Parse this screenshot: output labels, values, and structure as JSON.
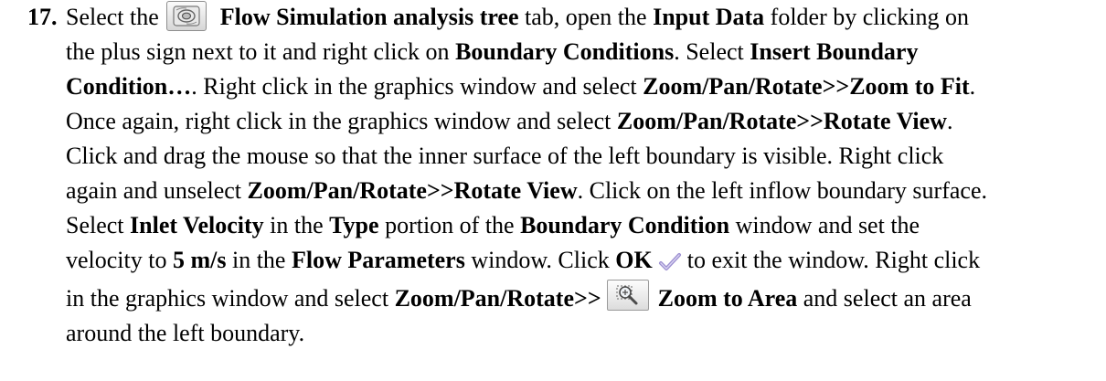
{
  "step": {
    "number": "17.",
    "l1": {
      "t1": "Select the",
      "b1": "Flow Simulation analysis tree",
      "t2": "tab, open the",
      "b2": "Input Data",
      "t3": "folder by clicking on"
    },
    "l2": {
      "t1": "the plus sign next to it and right click on",
      "b1": "Boundary Conditions",
      "t2": ". Select",
      "b2": "Insert Boundary"
    },
    "l3": {
      "b1": "Condition…",
      "t1": ". Right click in the graphics window and select",
      "b2": "Zoom/Pan/Rotate>>Zoom to Fit",
      "t2": "."
    },
    "l4": {
      "t1": "Once again, right click in the graphics window and select",
      "b1": "Zoom/Pan/Rotate>>Rotate View",
      "t2": "."
    },
    "l5": {
      "t1": "Click and drag the mouse so that the inner surface of the left boundary is visible. Right click"
    },
    "l6": {
      "t1": "again and unselect",
      "b1": "Zoom/Pan/Rotate>>Rotate View",
      "t2": ". Click on the left inflow boundary surface."
    },
    "l7": {
      "t1": "Select",
      "b1": "Inlet Velocity",
      "t2": "in the",
      "b2": "Type",
      "t3": "portion of the",
      "b3": "Boundary Condition",
      "t4": "window and set the"
    },
    "l8": {
      "t1": "velocity to",
      "b1": "5 m/s",
      "t2": "in the",
      "b2": "Flow Parameters",
      "t3": "window. Click",
      "b3": "OK",
      "t4": "to exit the window. Right click"
    },
    "l9": {
      "t1": "in the graphics window and select",
      "b1": "Zoom/Pan/Rotate>>",
      "b2": "Zoom to Area",
      "t2": "and select an area"
    },
    "l10": {
      "t1": "around the left boundary."
    }
  },
  "icons": {
    "tab": "flow-simulation-analysis-tree-icon",
    "ok": "ok-checkmark-icon",
    "zoom": "zoom-to-area-icon"
  },
  "colors": {
    "text": "#000000",
    "checkmark": "#9c8fd0"
  }
}
